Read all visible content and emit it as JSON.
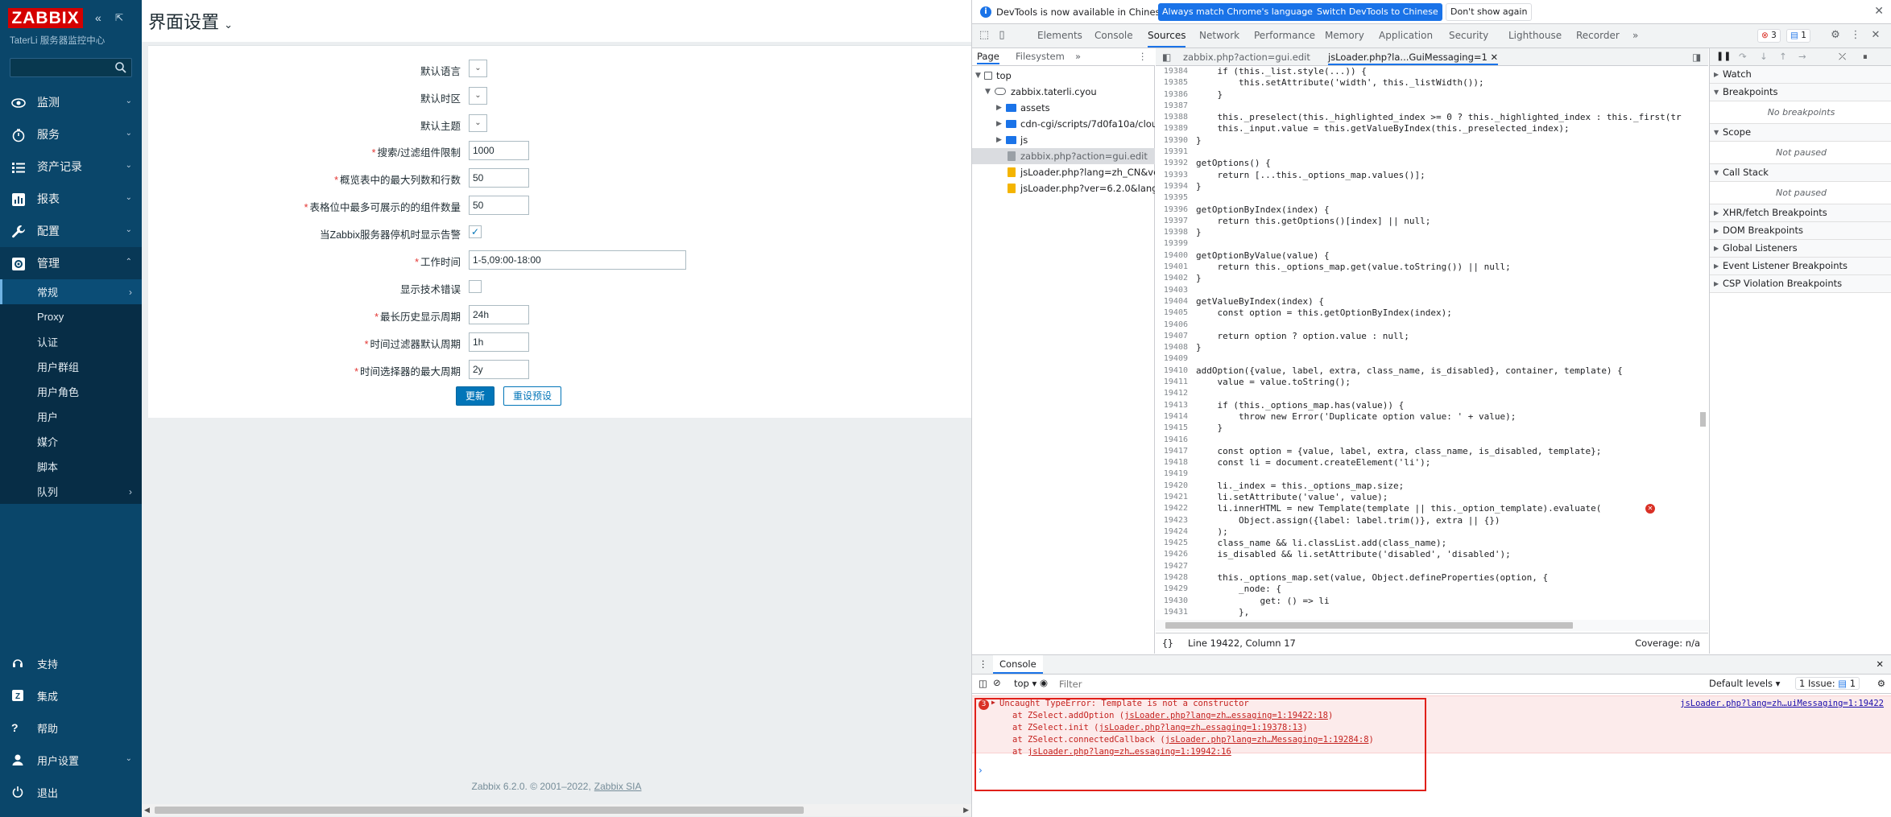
{
  "sidebar": {
    "logo": "ZABBIX",
    "subtitle": "TaterLi 服务器监控中心",
    "menu": [
      {
        "label": "监测",
        "icon": "eye-icon"
      },
      {
        "label": "服务",
        "icon": "clock-icon"
      },
      {
        "label": "资产记录",
        "icon": "list-icon"
      },
      {
        "label": "报表",
        "icon": "chart-icon"
      },
      {
        "label": "配置",
        "icon": "wrench-icon"
      },
      {
        "label": "管理",
        "icon": "admin-gear-icon"
      }
    ],
    "submenu": [
      "常规",
      "Proxy",
      "认证",
      "用户群组",
      "用户角色",
      "用户",
      "媒介",
      "脚本",
      "队列"
    ],
    "bottom": [
      {
        "label": "支持",
        "icon": "headset-icon"
      },
      {
        "label": "集成",
        "icon": "integration-icon"
      },
      {
        "label": "帮助",
        "icon": "help-icon"
      },
      {
        "label": "用户设置",
        "icon": "user-icon"
      },
      {
        "label": "退出",
        "icon": "power-icon"
      }
    ]
  },
  "main": {
    "title": "界面设置",
    "form": {
      "rows": [
        {
          "label": "默认语言",
          "required": false,
          "type": "select",
          "value": ""
        },
        {
          "label": "默认时区",
          "required": false,
          "type": "select",
          "value": ""
        },
        {
          "label": "默认主题",
          "required": false,
          "type": "select",
          "value": ""
        },
        {
          "label": "搜索/过滤组件限制",
          "required": true,
          "type": "text",
          "value": "1000"
        },
        {
          "label": "概览表中的最大列数和行数",
          "required": true,
          "type": "text",
          "value": "50"
        },
        {
          "label": "表格位中最多可展示的的组件数量",
          "required": true,
          "type": "text",
          "value": "50"
        },
        {
          "label": "当Zabbix服务器停机时显示告警",
          "required": false,
          "type": "checkbox",
          "checked": true
        },
        {
          "label": "工作时间",
          "required": true,
          "type": "wide",
          "value": "1-5,09:00-18:00"
        },
        {
          "label": "显示技术错误",
          "required": false,
          "type": "checkbox",
          "checked": false
        },
        {
          "label": "最长历史显示周期",
          "required": true,
          "type": "text",
          "value": "24h"
        },
        {
          "label": "时间过滤器默认周期",
          "required": true,
          "type": "text",
          "value": "1h"
        },
        {
          "label": "时间选择器的最大周期",
          "required": true,
          "type": "text",
          "value": "2y"
        }
      ],
      "update_button": "更新",
      "reset_button": "重设预设"
    },
    "footer_text": "Zabbix 6.2.0. © 2001–2022,",
    "footer_link": "Zabbix SIA"
  },
  "devtools": {
    "infobar": {
      "message": "DevTools is now available in Chinese!",
      "btn_match": "Always match Chrome's language",
      "btn_switch": "Switch DevTools to Chinese",
      "btn_dismiss": "Don't show again"
    },
    "tabs": [
      "Elements",
      "Console",
      "Sources",
      "Network",
      "Performance",
      "Memory",
      "Application",
      "Security",
      "Lighthouse",
      "Recorder"
    ],
    "active_tab": "Sources",
    "error_count": "3",
    "message_count": "1",
    "navigator": {
      "tabs": [
        "Page",
        "Filesystem"
      ],
      "tree": [
        {
          "label": "top",
          "indent": 0,
          "kind": "frame"
        },
        {
          "label": "zabbix.taterli.cyou",
          "indent": 1,
          "kind": "cloud"
        },
        {
          "label": "assets",
          "indent": 2,
          "kind": "folder"
        },
        {
          "label": "cdn-cgi/scripts/7d0fa10a/cloud",
          "indent": 2,
          "kind": "folder"
        },
        {
          "label": "js",
          "indent": 2,
          "kind": "folder"
        },
        {
          "label": "zabbix.php?action=gui.edit",
          "indent": 2,
          "kind": "file",
          "selected": true
        },
        {
          "label": "jsLoader.php?lang=zh_CN&ver",
          "indent": 2,
          "kind": "js"
        },
        {
          "label": "jsLoader.php?ver=6.2.0&lang=",
          "indent": 2,
          "kind": "js"
        }
      ]
    },
    "editor_tabs": [
      "zabbix.php?action=gui.edit",
      "jsLoader.php?la...GuiMessaging=1"
    ],
    "code": [
      {
        "n": "19384",
        "t": "    if (this._list.style(...)) {"
      },
      {
        "n": "19385",
        "t": "        this.setAttribute('width', this._listWidth());"
      },
      {
        "n": "19386",
        "t": "    }"
      },
      {
        "n": "19387",
        "t": ""
      },
      {
        "n": "19388",
        "t": "    this._preselect(this._highlighted_index >= 0 ? this._highlighted_index : this._first(tr"
      },
      {
        "n": "19389",
        "t": "    this._input.value = this.getValueByIndex(this._preselected_index);"
      },
      {
        "n": "19390",
        "t": "}"
      },
      {
        "n": "19391",
        "t": ""
      },
      {
        "n": "19392",
        "t": "getOptions() {"
      },
      {
        "n": "19393",
        "t": "    return [...this._options_map.values()];"
      },
      {
        "n": "19394",
        "t": "}"
      },
      {
        "n": "19395",
        "t": ""
      },
      {
        "n": "19396",
        "t": "getOptionByIndex(index) {"
      },
      {
        "n": "19397",
        "t": "    return this.getOptions()[index] || null;"
      },
      {
        "n": "19398",
        "t": "}"
      },
      {
        "n": "19399",
        "t": ""
      },
      {
        "n": "19400",
        "t": "getOptionByValue(value) {"
      },
      {
        "n": "19401",
        "t": "    return this._options_map.get(value.toString()) || null;"
      },
      {
        "n": "19402",
        "t": "}"
      },
      {
        "n": "19403",
        "t": ""
      },
      {
        "n": "19404",
        "t": "getValueByIndex(index) {"
      },
      {
        "n": "19405",
        "t": "    const option = this.getOptionByIndex(index);"
      },
      {
        "n": "19406",
        "t": ""
      },
      {
        "n": "19407",
        "t": "    return option ? option.value : null;"
      },
      {
        "n": "19408",
        "t": "}"
      },
      {
        "n": "19409",
        "t": ""
      },
      {
        "n": "19410",
        "t": "addOption({value, label, extra, class_name, is_disabled}, container, template) {"
      },
      {
        "n": "19411",
        "t": "    value = value.toString();"
      },
      {
        "n": "19412",
        "t": ""
      },
      {
        "n": "19413",
        "t": "    if (this._options_map.has(value)) {"
      },
      {
        "n": "19414",
        "t": "        throw new Error('Duplicate option value: ' + value);"
      },
      {
        "n": "19415",
        "t": "    }"
      },
      {
        "n": "19416",
        "t": ""
      },
      {
        "n": "19417",
        "t": "    const option = {value, label, extra, class_name, is_disabled, template};"
      },
      {
        "n": "19418",
        "t": "    const li = document.createElement('li');"
      },
      {
        "n": "19419",
        "t": ""
      },
      {
        "n": "19420",
        "t": "    li._index = this._options_map.size;"
      },
      {
        "n": "19421",
        "t": "    li.setAttribute('value', value);"
      },
      {
        "n": "19422",
        "t": "    li.innerHTML = new Template(template || this._option_template).evaluate("
      },
      {
        "n": "19423",
        "t": "        Object.assign({label: label.trim()}, extra || {})"
      },
      {
        "n": "19424",
        "t": "    );"
      },
      {
        "n": "19425",
        "t": "    class_name && li.classList.add(class_name);"
      },
      {
        "n": "19426",
        "t": "    is_disabled && li.setAttribute('disabled', 'disabled');"
      },
      {
        "n": "19427",
        "t": ""
      },
      {
        "n": "19428",
        "t": "    this._options_map.set(value, Object.defineProperties(option, {"
      },
      {
        "n": "19429",
        "t": "        _node: {"
      },
      {
        "n": "19430",
        "t": "            get: () => li"
      },
      {
        "n": "19431",
        "t": "        },"
      },
      {
        "n": "19432",
        "t": "        ..."
      }
    ],
    "status": {
      "position": "Line 19422, Column 17",
      "coverage": "Coverage: n/a"
    },
    "debugger": {
      "sections": [
        {
          "label": "Watch",
          "note": ""
        },
        {
          "label": "Breakpoints",
          "note": "No breakpoints"
        },
        {
          "label": "Scope",
          "note": "Not paused"
        },
        {
          "label": "Call Stack",
          "note": "Not paused"
        },
        {
          "label": "XHR/fetch Breakpoints",
          "note": ""
        },
        {
          "label": "DOM Breakpoints",
          "note": ""
        },
        {
          "label": "Global Listeners",
          "note": ""
        },
        {
          "label": "Event Listener Breakpoints",
          "note": ""
        },
        {
          "label": "CSP Violation Breakpoints",
          "note": ""
        }
      ]
    },
    "console": {
      "tab": "Console",
      "context": "top",
      "filter_placeholder": "Filter",
      "levels": "Default levels",
      "issues": "1 Issue:",
      "issues_count": "1",
      "error_repeat": "3",
      "error_title": "Uncaught TypeError: Template is not a constructor",
      "source_link": "jsLoader.php?lang=zh…uiMessaging=1:19422",
      "stack": [
        {
          "prefix": "at ZSelect.addOption (",
          "link": "jsLoader.php?lang=zh…essaging=1:19422:18",
          "suffix": ")"
        },
        {
          "prefix": "at ZSelect.init (",
          "link": "jsLoader.php?lang=zh…essaging=1:19378:13",
          "suffix": ")"
        },
        {
          "prefix": "at ZSelect.connectedCallback (",
          "link": "jsLoader.php?lang=zh…Messaging=1:19284:8",
          "suffix": ")"
        },
        {
          "prefix": "at ",
          "link": "jsLoader.php?lang=zh…essaging=1:19942:16",
          "suffix": ""
        }
      ]
    }
  }
}
